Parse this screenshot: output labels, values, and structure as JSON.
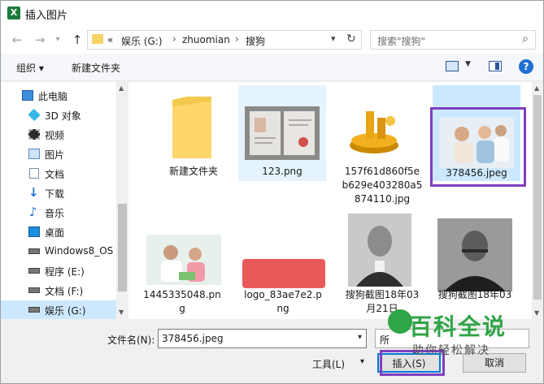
{
  "window": {
    "title": "插入图片",
    "app_icon": "X"
  },
  "nav": {
    "breadcrumbs": [
      "«",
      "娱乐 (G:)",
      "zhuomian",
      "搜狗"
    ],
    "search_placeholder": "搜索\"搜狗\""
  },
  "toolbar": {
    "organize": "组织 ▾",
    "new_folder": "新建文件夹",
    "help": "?"
  },
  "sidebar": {
    "items": [
      {
        "label": "此电脑",
        "icon": "computer-icon"
      },
      {
        "label": "3D 对象",
        "icon": "3d-objects-icon"
      },
      {
        "label": "视频",
        "icon": "video-icon"
      },
      {
        "label": "图片",
        "icon": "pictures-icon"
      },
      {
        "label": "文档",
        "icon": "documents-icon"
      },
      {
        "label": "下载",
        "icon": "download-icon"
      },
      {
        "label": "音乐",
        "icon": "music-icon"
      },
      {
        "label": "桌面",
        "icon": "desktop-icon"
      },
      {
        "label": "Windows8_OS",
        "icon": "drive-icon"
      },
      {
        "label": "程序 (E:)",
        "icon": "drive-icon"
      },
      {
        "label": "文档 (F:)",
        "icon": "drive-icon"
      },
      {
        "label": "娱乐 (G:)",
        "icon": "drive-icon"
      }
    ]
  },
  "files": [
    {
      "name": "新建文件夹",
      "kind": "folder"
    },
    {
      "name": "123.png",
      "kind": "image-certificate"
    },
    {
      "name": "157f61d860f5eb629e403280a5874110.jpg",
      "kind": "image-gold-coins"
    },
    {
      "name": "378456.jpeg",
      "kind": "image-family"
    },
    {
      "name": "1445335048.png",
      "kind": "image-people"
    },
    {
      "name": "logo_83ae7e2.png",
      "kind": "image-logo"
    },
    {
      "name": "搜狗截图18年03月21日",
      "kind": "image-portrait"
    },
    {
      "name": "搜狗截图18年03",
      "kind": "image-portrait2"
    }
  ],
  "file_labels": {
    "f0": [
      "新建文件夹"
    ],
    "f1": [
      "123.png"
    ],
    "f2": [
      "157f61d860f5e",
      "b629e403280a5",
      "874110.jpg"
    ],
    "f3": [
      "378456.jpeg"
    ],
    "f4": [
      "1445335048.pn",
      "g"
    ],
    "f5": [
      "logo_83ae7e2.p",
      "ng"
    ],
    "f6": [
      "搜狗截图18年03",
      "月21日"
    ],
    "f7": [
      "搜狗截图18年03"
    ]
  },
  "footer": {
    "filename_label": "文件名(N):",
    "filename_value": "378456.jpeg",
    "filetype_text": "所",
    "tools_label": "工具(L)",
    "insert_label": "插入(S)",
    "cancel_label": "取消"
  },
  "watermark": {
    "title": "百科全说",
    "subtitle": "助你轻松解决"
  },
  "colors": {
    "accent": "#0078d7",
    "selection": "#cce8ff",
    "highlight_frame": "#7f3fbf",
    "watermark": "#2fa546"
  }
}
